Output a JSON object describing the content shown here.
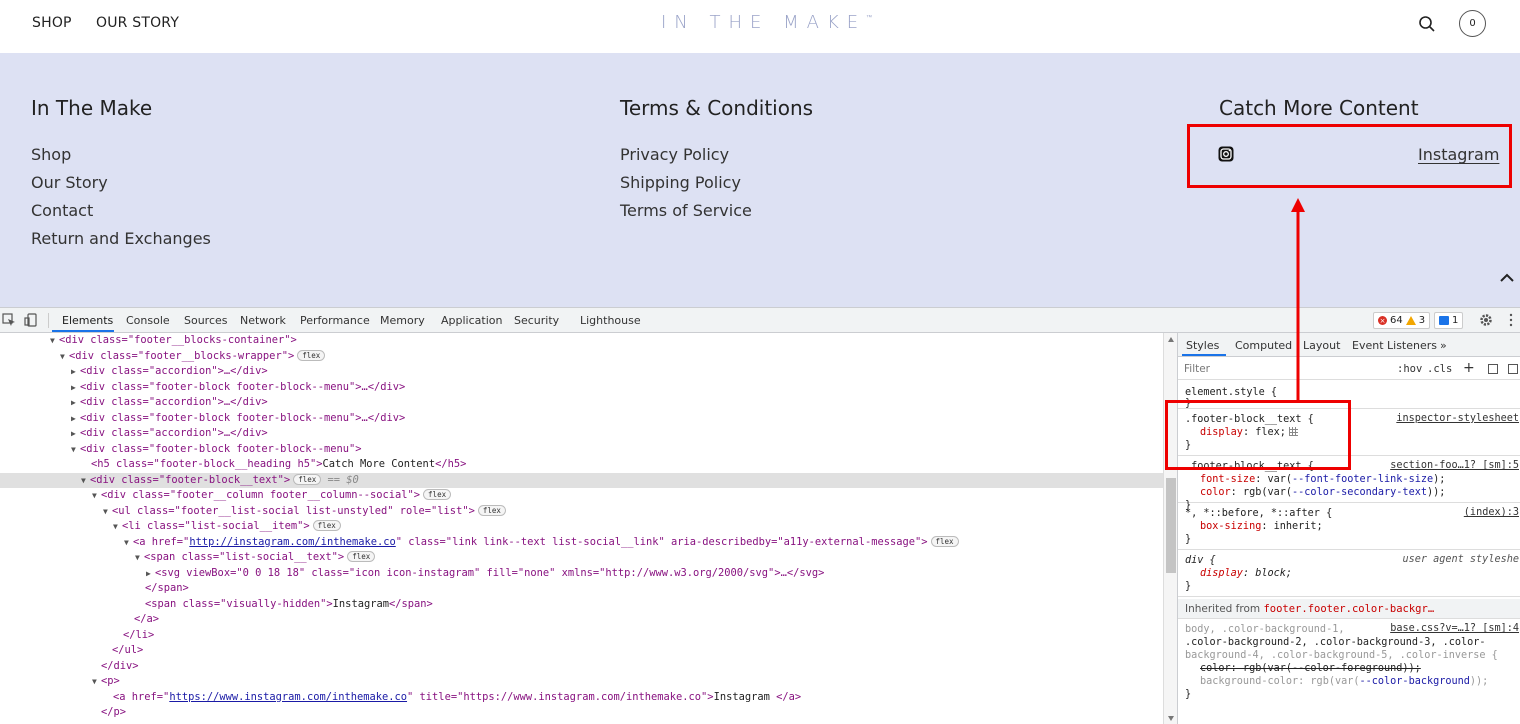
{
  "store_header": {
    "nav": [
      "SHOP",
      "OUR STORY"
    ],
    "logo": "IN THE MAKE",
    "logo_mark": "™",
    "cart_count": "0"
  },
  "footer": {
    "columns": [
      {
        "heading": "In The Make",
        "links": [
          "Shop",
          "Our Story",
          "Contact",
          "Return and Exchanges"
        ]
      },
      {
        "heading": "Terms & Conditions",
        "links": [
          "Privacy Policy",
          "Shipping Policy",
          "Terms of Service"
        ]
      },
      {
        "heading": "Catch More Content",
        "links": []
      }
    ],
    "instagram_label": "Instagram",
    "background": "#dde1f3"
  },
  "devtools": {
    "tabs": [
      "Elements",
      "Console",
      "Sources",
      "Network",
      "Performance",
      "Memory",
      "Application",
      "Security",
      "Lighthouse"
    ],
    "active_tab": "Elements",
    "errors": "64",
    "warnings": "3",
    "messages": "1",
    "styles_tabs": [
      "Styles",
      "Computed",
      "Layout",
      "Event Listeners",
      "»"
    ],
    "filter_placeholder": "Filter",
    "hov": ":hov",
    "cls": ".cls",
    "plus": "+",
    "dom": {
      "l0": "<div class=\"footer__blocks-container\">",
      "l1_a": "<div class=\"footer__blocks-wrapper\">",
      "accordion": "<div class=\"accordion\">…</div>",
      "menu_collapsed": "<div class=\"footer-block footer-block--menu\">…</div>",
      "menu_open": "<div class=\"footer-block footer-block--menu\">",
      "h5_open": "<h5 class=\"footer-block__heading h5\">",
      "h5_text": "Catch More Content",
      "h5_close": "</h5>",
      "text_div": "<div class=\"footer-block__text\">",
      "eq": "== $0",
      "column": "<div class=\"footer__column footer__column--social\">",
      "ul": "<ul class=\"footer__list-social list-unstyled\" role=\"list\">",
      "li": "<li class=\"list-social__item\">",
      "a_pre": "<a href=\"",
      "a_href": "http://instagram.com/inthemake.co",
      "a_post": "\" class=\"link link--text list-social__link\" aria-describedby=\"a11y-external-message\">",
      "span_text": "<span class=\"list-social__text\">",
      "svg": "<svg viewBox=\"0 0 18 18\" class=\"icon icon-instagram\" fill=\"none\" xmlns=\"http://www.w3.org/2000/svg\">…</svg>",
      "span_close": "</span>",
      "span_hidden_open": "<span class=\"visually-hidden\">",
      "span_hidden_text": "Instagram",
      "span_hidden_close": "</span>",
      "a_close": "</a>",
      "li_close": "</li>",
      "ul_close": "</ul>",
      "div_close": "</div>",
      "p_open": "<p>",
      "p_a_pre": "<a href=\"",
      "p_a_href": "https://www.instagram.com/inthemake.co",
      "p_a_mid": "\" title=\"https://www.instagram.com/inthemake.co\">",
      "p_a_text": "Instagram ",
      "p_a_close": "</a>",
      "p_close": "</p>",
      "flex": "flex"
    },
    "styles": {
      "element_style": "element.style {",
      "close": "}",
      "r1_sel": ".footer-block__text {",
      "r1_src": "inspector-stylesheet",
      "r1_prop": "display",
      "r1_val": "flex;",
      "r2_sel": ".footer-block__text {",
      "r2_src": "section-foo…1? [sm]:5",
      "r2_p1": "font-size",
      "r2_v1_pre": "var(",
      "r2_v1_var": "--font-footer-link-size",
      "r2_v1_post": ");",
      "r2_p2": "color",
      "r2_v2_pre": "rgb(var(",
      "r2_v2_var": "--color-secondary-text",
      "r2_v2_post": "));",
      "r3_sel": "*, *::before, *::after {",
      "r3_src": "(index):3",
      "r3_prop": "box-sizing",
      "r3_val": "inherit;",
      "r4_sel": "div {",
      "r4_src": "user agent styleshe",
      "r4_prop": "display",
      "r4_val": "block;",
      "inherited_label": "Inherited from ",
      "inherited_from": "footer.footer.color-backgr…",
      "r5_sel1": "body, .color-background-1,",
      "r5_sel2": ".color-background-2, .color-background-3, .color-",
      "r5_sel3": "background-4, .color-background-5, .color-inverse {",
      "r5_src": "base.css?v=…1? [sm]:4",
      "r5_p1": "color: rgb(var(--color-foreground));",
      "r5_p2": "background-color",
      "r5_v2_pre": "rgb(var(",
      "r5_v2_var": "--color-background",
      "r5_v2_post": "));"
    }
  },
  "annotation_color": "#e00000"
}
